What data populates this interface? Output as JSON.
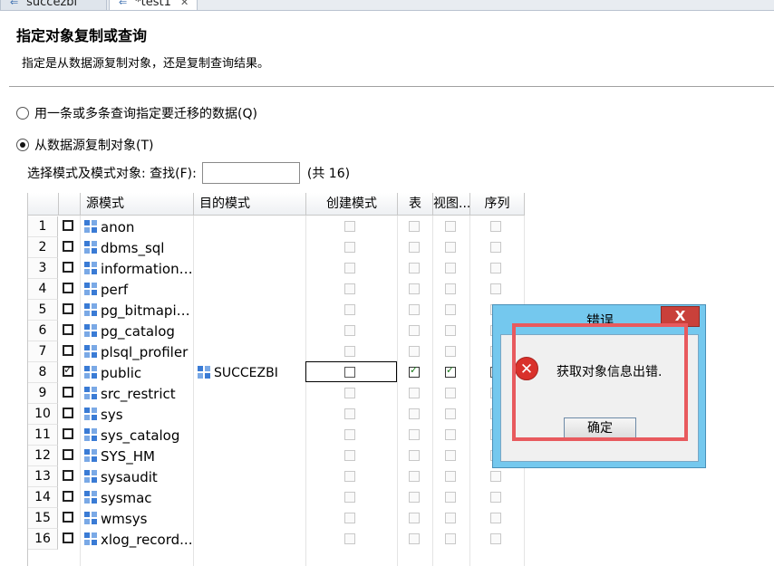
{
  "tabs": [
    {
      "label": "succezbi"
    },
    {
      "label": "*test1"
    }
  ],
  "header": {
    "title": "指定对象复制或查询",
    "description": "指定是从数据源复制对象，还是复制查询结果。"
  },
  "options": {
    "query_label": "用一条或多条查询指定要迁移的数据(Q)",
    "copy_label": "从数据源复制对象(T)",
    "selected": "copy"
  },
  "search": {
    "label": "选择模式及模式对象: 查找(F):",
    "value": "",
    "count": "(共 16)"
  },
  "table": {
    "columns": [
      "源模式",
      "目的模式",
      "创建模式",
      "表",
      "视图...",
      "序列"
    ],
    "rows": [
      {
        "num": "1",
        "source": "anon",
        "target": "",
        "selected": false
      },
      {
        "num": "2",
        "source": "dbms_sql",
        "target": "",
        "selected": false
      },
      {
        "num": "3",
        "source": "information_...",
        "target": "",
        "selected": false
      },
      {
        "num": "4",
        "source": "perf",
        "target": "",
        "selected": false
      },
      {
        "num": "5",
        "source": "pg_bitmapin...",
        "target": "",
        "selected": false
      },
      {
        "num": "6",
        "source": "pg_catalog",
        "target": "",
        "selected": false
      },
      {
        "num": "7",
        "source": "plsql_profiler",
        "target": "",
        "selected": false
      },
      {
        "num": "8",
        "source": "public",
        "target": "SUCCEZBI",
        "selected": true
      },
      {
        "num": "9",
        "source": "src_restrict",
        "target": "",
        "selected": false
      },
      {
        "num": "10",
        "source": "sys",
        "target": "",
        "selected": false
      },
      {
        "num": "11",
        "source": "sys_catalog",
        "target": "",
        "selected": false
      },
      {
        "num": "12",
        "source": "SYS_HM",
        "target": "",
        "selected": false
      },
      {
        "num": "13",
        "source": "sysaudit",
        "target": "",
        "selected": false
      },
      {
        "num": "14",
        "source": "sysmac",
        "target": "",
        "selected": false
      },
      {
        "num": "15",
        "source": "wmsys",
        "target": "",
        "selected": false
      },
      {
        "num": "16",
        "source": "xlog_record...",
        "target": "",
        "selected": false
      }
    ]
  },
  "dialog": {
    "title": "错误",
    "close_label": "X",
    "message": "获取对象信息出错.",
    "ok_label": "确定"
  },
  "icons": {
    "tab": "arrow-left-icon",
    "schema": "schema-grid-icon",
    "error": "error-x-icon"
  },
  "colors": {
    "dialog_frame": "#74c8ee",
    "close_button": "#c9403a",
    "highlight": "#e85a5e",
    "schema_icon": "#3a7bd5"
  }
}
